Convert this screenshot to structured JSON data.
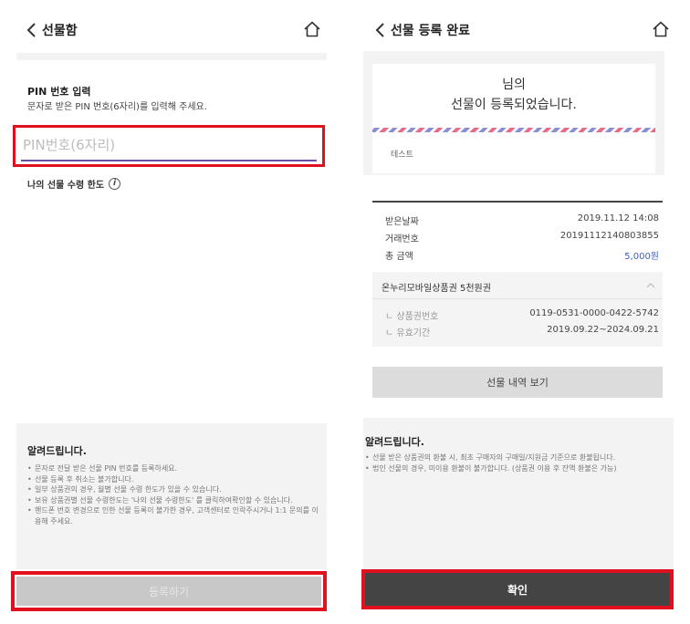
{
  "left": {
    "header": {
      "title": "선물함"
    },
    "pin": {
      "title": "PIN 번호 입력",
      "desc": "문자로 받은 PIN 번호(6자리)를 입력해 주세요.",
      "placeholder": "PIN번호(6자리)"
    },
    "limit_label": "나의 선물 수령 한도",
    "notice": {
      "title": "알려드립니다.",
      "items": [
        "문자로 전달 받은 선물 PIN 번호를 등록하세요.",
        "선물 등록 후 취소는 불가합니다.",
        "일부 상품권의 경우, 월별 선물 수령 한도가 있을 수 있습니다.",
        "보유 상품권별 선물 수령한도는 '나의 선물 수령한도' 를 클릭하여확인할 수 있습니다.",
        "핸드폰 번호 변경으로 인한 선물 등록이 불가한 경우, 고객센터로 인락주시거나 1:1 문의를 이용해 주세요."
      ]
    },
    "register_button": "등록하기"
  },
  "right": {
    "header": {
      "title": "선물 등록 완료"
    },
    "done": {
      "line1": "님의",
      "line2": "선물이 등록되었습니다.",
      "message": "테스트"
    },
    "details": {
      "received_date_label": "받은날짜",
      "received_date": "2019.11.12 14:08",
      "transaction_label": "거래번호",
      "transaction_no": "20191112140803855",
      "total_label": "총 금액",
      "total": "5,000원",
      "product_name": "온누리모바일상품권 5천원권",
      "voucher_no_label": "ㄴ 상품권번호",
      "voucher_no": "0119-0531-0000-0422-5742",
      "validity_label": "ㄴ 유효기간",
      "validity": "2019.09.22~2024.09.21"
    },
    "history_button": "선물 내역 보기",
    "notice": {
      "title": "알려드립니다.",
      "items": [
        "선물 받은 상품권의 환불 시, 최초 구매자의 구매일/지원금 기준으로 환불됩니다.",
        "법인 선물의 경우, 미이용 환불이 불가합니다. (상품권 이용 후 잔액 환불은 가능)"
      ]
    },
    "confirm_button": "확인"
  },
  "colors": {
    "highlight": "#e0101e",
    "input_underline": "#6a4fa8",
    "amount": "#3d5ec9",
    "confirm_bg": "#444444"
  }
}
